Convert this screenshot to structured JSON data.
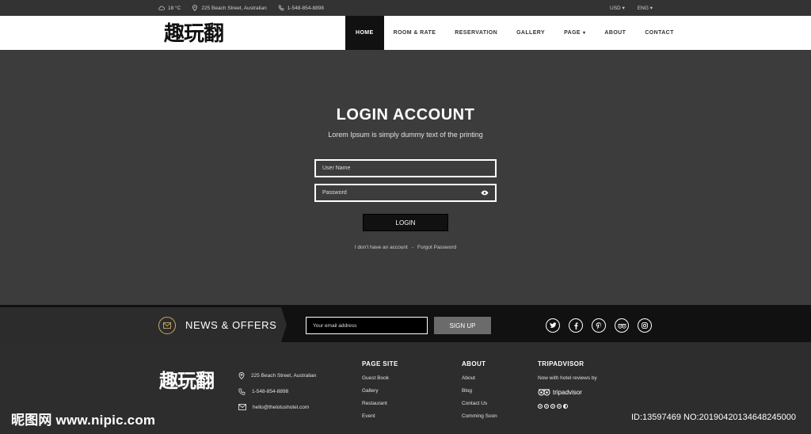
{
  "topbar": {
    "weather": "18 °C",
    "address": "225 Beach Street, Australian",
    "phone": "1-548-854-8898",
    "currency": "USD",
    "language": "ENG"
  },
  "brand": {
    "logo_text": "趣玩翻"
  },
  "nav": {
    "items": [
      {
        "label": "HOME"
      },
      {
        "label": "ROOM & RATE"
      },
      {
        "label": "RESERVATION"
      },
      {
        "label": "GALLERY"
      },
      {
        "label": "PAGE"
      },
      {
        "label": "ABOUT"
      },
      {
        "label": "CONTACT"
      }
    ]
  },
  "login": {
    "title": "LOGIN ACCOUNT",
    "subtitle": "Lorem Ipsum is simply dummy text of the printing",
    "username_placeholder": "User Name",
    "password_placeholder": "Password",
    "button_label": "LOGIN",
    "no_account_link": "I don't have an account",
    "separator": "-",
    "forgot_link": "Forgot Password"
  },
  "news": {
    "title": "NEWS & OFFERS",
    "email_placeholder": "Your email address",
    "signup_label": "SIGN UP",
    "socials": [
      "twitter-icon",
      "facebook-icon",
      "pinterest-icon",
      "tripadvisor-icon",
      "instagram-icon"
    ]
  },
  "footer": {
    "logo_text": "趣玩翻",
    "address": "225 Beach Street, Australian",
    "phone": "1-548-854-8898",
    "email": "hello@thelotushotel.com",
    "page_site": {
      "title": "PAGE SITE",
      "links": [
        "Guest Book",
        "Gallery",
        "Restaurant",
        "Event"
      ]
    },
    "about": {
      "title": "ABOUT",
      "links": [
        "About",
        "Blog",
        "Contact Us",
        "Comming Soon"
      ]
    },
    "tripadvisor": {
      "title": "TRIPADVISOR",
      "note": "Now with hotel reviews by",
      "brand": "tripadvisor",
      "rating": 4.5
    }
  },
  "watermark": {
    "site": "昵图网 www.nipic.com",
    "id_text": "ID:13597469 NO:20190420134648245000"
  },
  "colors": {
    "accent_gold": "#c9a867",
    "hero_bg": "#3c3c3c",
    "nav_active": "#111111"
  }
}
